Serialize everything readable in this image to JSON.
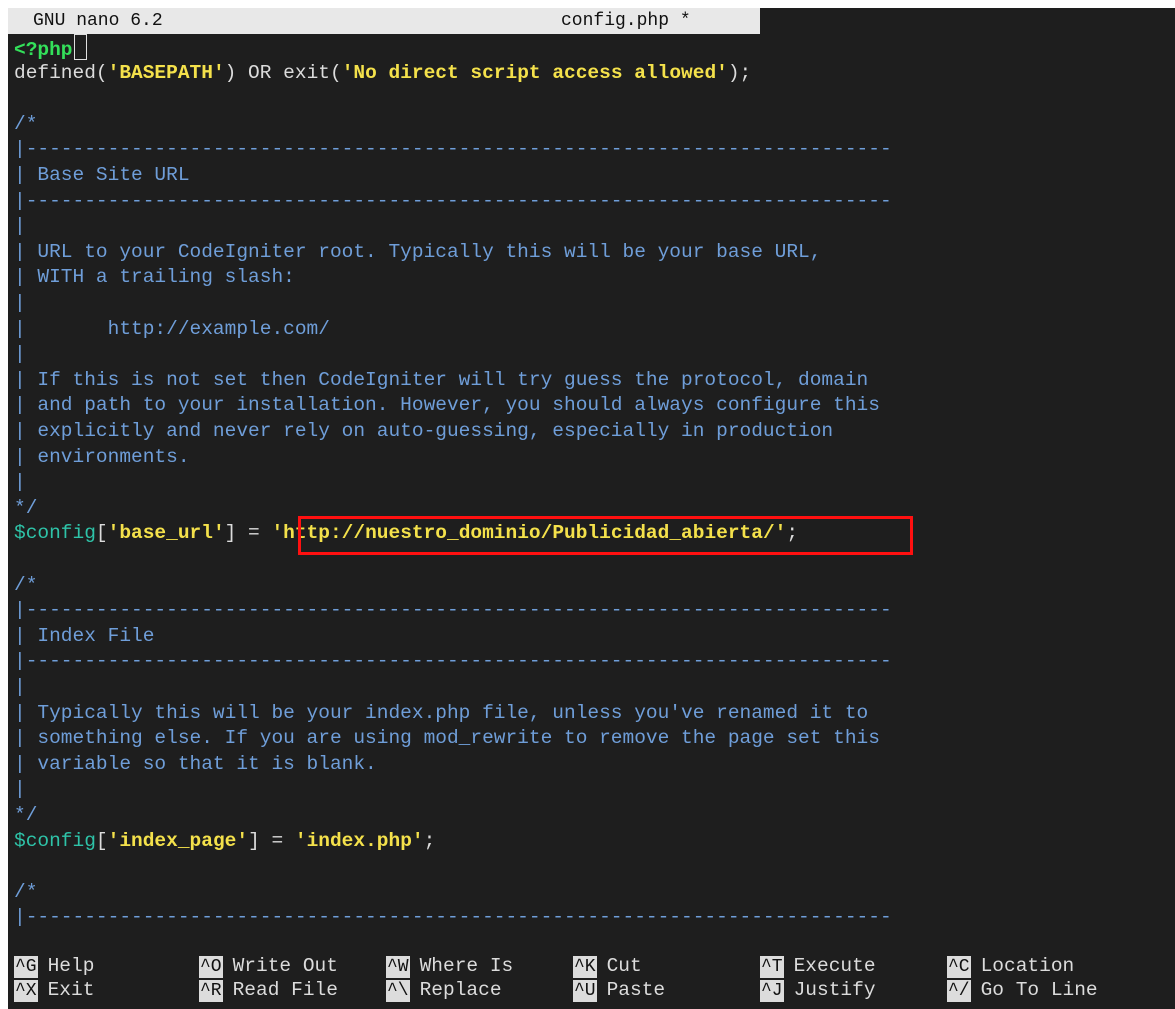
{
  "titlebar": {
    "app": "GNU nano 6.2",
    "filename": "config.php *"
  },
  "code_lines": [
    {
      "segments": [
        {
          "t": "<?php",
          "c": "green"
        }
      ],
      "cursor": true
    },
    {
      "segments": [
        {
          "t": "defined(",
          "c": "plain"
        },
        {
          "t": "'BASEPATH'",
          "c": "str"
        },
        {
          "t": ") OR exit(",
          "c": "plain"
        },
        {
          "t": "'No direct script access allowed'",
          "c": "str"
        },
        {
          "t": ");",
          "c": "plain"
        }
      ]
    },
    {
      "segments": []
    },
    {
      "segments": [
        {
          "t": "/*",
          "c": "com"
        }
      ]
    },
    {
      "segments": [
        {
          "t": "|--------------------------------------------------------------------------",
          "c": "com"
        }
      ]
    },
    {
      "segments": [
        {
          "t": "| Base Site URL",
          "c": "com"
        }
      ]
    },
    {
      "segments": [
        {
          "t": "|--------------------------------------------------------------------------",
          "c": "com"
        }
      ]
    },
    {
      "segments": [
        {
          "t": "|",
          "c": "com"
        }
      ]
    },
    {
      "segments": [
        {
          "t": "| URL to your CodeIgniter root. Typically this will be your base URL,",
          "c": "com"
        }
      ]
    },
    {
      "segments": [
        {
          "t": "| WITH a trailing slash:",
          "c": "com"
        }
      ]
    },
    {
      "segments": [
        {
          "t": "|",
          "c": "com"
        }
      ]
    },
    {
      "segments": [
        {
          "t": "|       http://example.com/",
          "c": "com"
        }
      ]
    },
    {
      "segments": [
        {
          "t": "|",
          "c": "com"
        }
      ]
    },
    {
      "segments": [
        {
          "t": "| If this is not set then CodeIgniter will try guess the protocol, domain",
          "c": "com"
        }
      ]
    },
    {
      "segments": [
        {
          "t": "| and path to your installation. However, you should always configure this",
          "c": "com"
        }
      ]
    },
    {
      "segments": [
        {
          "t": "| explicitly and never rely on auto-guessing, especially in production",
          "c": "com"
        }
      ]
    },
    {
      "segments": [
        {
          "t": "| environments.",
          "c": "com"
        }
      ]
    },
    {
      "segments": [
        {
          "t": "|",
          "c": "com"
        }
      ]
    },
    {
      "segments": [
        {
          "t": "*/",
          "c": "com"
        }
      ]
    },
    {
      "segments": [
        {
          "t": "$config",
          "c": "var"
        },
        {
          "t": "[",
          "c": "plain"
        },
        {
          "t": "'base_url'",
          "c": "str"
        },
        {
          "t": "] = ",
          "c": "plain"
        },
        {
          "t": "'http://nuestro_dominio/Publicidad_abierta/'",
          "c": "str"
        },
        {
          "t": ";",
          "c": "plain"
        }
      ]
    },
    {
      "segments": []
    },
    {
      "segments": [
        {
          "t": "/*",
          "c": "com"
        }
      ]
    },
    {
      "segments": [
        {
          "t": "|--------------------------------------------------------------------------",
          "c": "com"
        }
      ]
    },
    {
      "segments": [
        {
          "t": "| Index File",
          "c": "com"
        }
      ]
    },
    {
      "segments": [
        {
          "t": "|--------------------------------------------------------------------------",
          "c": "com"
        }
      ]
    },
    {
      "segments": [
        {
          "t": "|",
          "c": "com"
        }
      ]
    },
    {
      "segments": [
        {
          "t": "| Typically this will be your index.php file, unless you've renamed it to",
          "c": "com"
        }
      ]
    },
    {
      "segments": [
        {
          "t": "| something else. If you are using mod_rewrite to remove the page set this",
          "c": "com"
        }
      ]
    },
    {
      "segments": [
        {
          "t": "| variable so that it is blank.",
          "c": "com"
        }
      ]
    },
    {
      "segments": [
        {
          "t": "|",
          "c": "com"
        }
      ]
    },
    {
      "segments": [
        {
          "t": "*/",
          "c": "com"
        }
      ]
    },
    {
      "segments": [
        {
          "t": "$config",
          "c": "var"
        },
        {
          "t": "[",
          "c": "plain"
        },
        {
          "t": "'index_page'",
          "c": "str"
        },
        {
          "t": "] = ",
          "c": "plain"
        },
        {
          "t": "'index.php'",
          "c": "str"
        },
        {
          "t": ";",
          "c": "plain"
        }
      ]
    },
    {
      "segments": []
    },
    {
      "segments": [
        {
          "t": "/*",
          "c": "com"
        }
      ]
    },
    {
      "segments": [
        {
          "t": "|--------------------------------------------------------------------------",
          "c": "com"
        }
      ]
    }
  ],
  "shortcuts_row1": [
    {
      "key": "^G",
      "label": "Help"
    },
    {
      "key": "^O",
      "label": "Write Out"
    },
    {
      "key": "^W",
      "label": "Where Is"
    },
    {
      "key": "^K",
      "label": "Cut"
    },
    {
      "key": "^T",
      "label": "Execute"
    },
    {
      "key": "^C",
      "label": "Location"
    }
  ],
  "shortcuts_row2": [
    {
      "key": "^X",
      "label": "Exit"
    },
    {
      "key": "^R",
      "label": "Read File"
    },
    {
      "key": "^\\",
      "label": "Replace"
    },
    {
      "key": "^U",
      "label": "Paste"
    },
    {
      "key": "^J",
      "label": "Justify"
    },
    {
      "key": "^/",
      "label": "Go To Line"
    }
  ],
  "colors": {
    "background": "#1e1e1e",
    "comment": "#6f9ed9",
    "string": "#f4e14b",
    "variable": "#2ec3a8",
    "php_tag": "#33e05a",
    "highlight_box": "#ff1010"
  }
}
